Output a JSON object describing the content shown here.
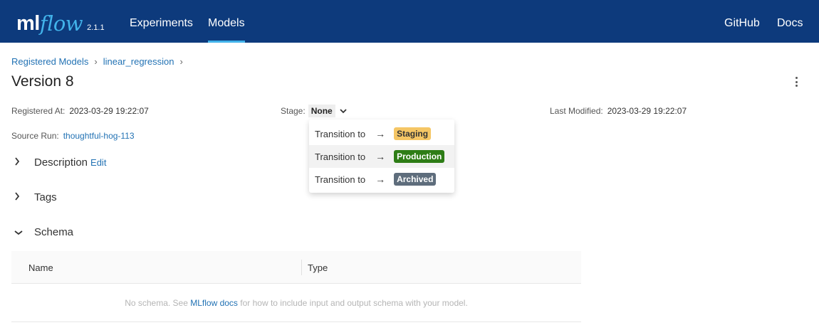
{
  "header": {
    "logo_ml": "ml",
    "logo_flow": "flow",
    "version": "2.1.1",
    "nav": [
      "Experiments",
      "Models"
    ],
    "right_links": [
      "GitHub",
      "Docs"
    ]
  },
  "breadcrumb": {
    "items": [
      "Registered Models",
      "linear_regression"
    ],
    "separator": "›"
  },
  "page_title": "Version 8",
  "meta": {
    "registered_label": "Registered At:",
    "registered_value": "2023-03-29 19:22:07",
    "stage_label": "Stage:",
    "stage_value": "None",
    "modified_label": "Last Modified:",
    "modified_value": "2023-03-29 19:22:07",
    "source_label": "Source Run:",
    "source_value": "thoughtful-hog-113"
  },
  "sections": {
    "description": "Description",
    "edit": "Edit",
    "tags": "Tags",
    "schema": "Schema"
  },
  "schema_table": {
    "col_name": "Name",
    "col_type": "Type",
    "empty_prefix": "No schema. See ",
    "empty_link": "MLflow docs",
    "empty_suffix": " for how to include input and output schema with your model."
  },
  "stage_dropdown": {
    "items": [
      {
        "label": "Transition to",
        "arrow": "→",
        "stage": "Staging"
      },
      {
        "label": "Transition to",
        "arrow": "→",
        "stage": "Production"
      },
      {
        "label": "Transition to",
        "arrow": "→",
        "stage": "Archived"
      }
    ]
  },
  "colors": {
    "header_bg": "#0d3a7c",
    "accent": "#42b3ea",
    "link": "#2272b4",
    "staging": "#f5c665",
    "production": "#2e7d16",
    "archived": "#5e6d7c"
  },
  "icons": [
    "chevron-right-icon",
    "chevron-down-icon",
    "kebab-menu-icon",
    "arrow-right-icon"
  ]
}
